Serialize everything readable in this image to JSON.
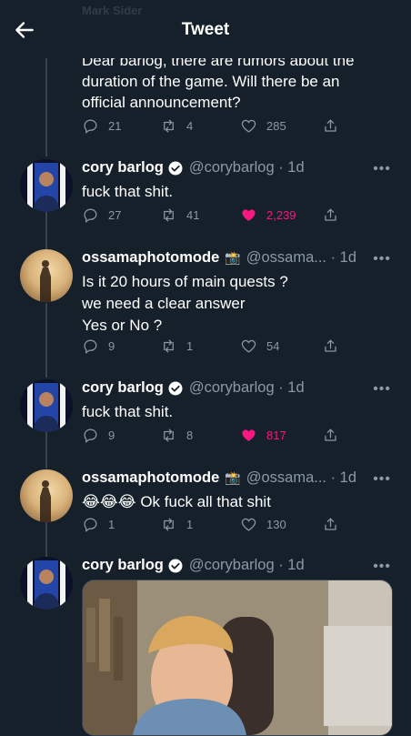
{
  "header": {
    "title": "Tweet",
    "ghost_text": "Mark Sider"
  },
  "top_tweet": {
    "text": "Dear barlog, there are rumors about the duration of the game. Will there be an official announcement?",
    "replies": "21",
    "retweets": "4",
    "likes": "285"
  },
  "tweets": [
    {
      "name": "cory barlog",
      "handle": "@corybarlog · 1d",
      "text": "fuck that shit.",
      "replies": "27",
      "retweets": "41",
      "likes": "2,239",
      "liked": true
    },
    {
      "name": "ossamaphotomode",
      "handle": "@ossama... · 1d",
      "badge": "📸",
      "text": "Is it 20 hours of main quests ?\nwe need a clear answer\nYes or No ?",
      "replies": "9",
      "retweets": "1",
      "likes": "54",
      "liked": false
    },
    {
      "name": "cory barlog",
      "handle": "@corybarlog · 1d",
      "text": "fuck that shit.",
      "replies": "9",
      "retweets": "8",
      "likes": "817",
      "liked": true
    },
    {
      "name": "ossamaphotomode",
      "handle": "@ossama... · 1d",
      "badge": "📸",
      "text": "😂😂😂 Ok fuck all that shit",
      "replies": "1",
      "retweets": "1",
      "likes": "130",
      "liked": false
    },
    {
      "name": "cory barlog",
      "handle": "@corybarlog · 1d",
      "text": ""
    }
  ],
  "colors": {
    "background": "#15202b",
    "muted": "#8b98a5",
    "like": "#f91880",
    "verified": "#ffffff"
  },
  "icons": [
    "back-arrow-icon",
    "reply-icon",
    "retweet-icon",
    "heart-icon",
    "share-icon",
    "verified-icon",
    "more-icon"
  ]
}
